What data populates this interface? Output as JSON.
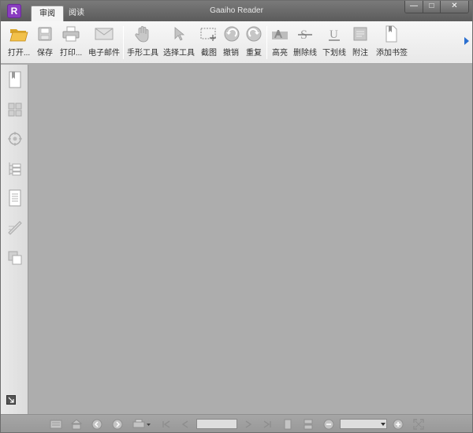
{
  "app": {
    "title": "Gaaiho Reader",
    "logo_letter": "R",
    "tabs": [
      {
        "label": "审阅",
        "active": true
      },
      {
        "label": "阅读",
        "active": false
      }
    ],
    "window_controls": {
      "minimize": "—",
      "maximize": "□",
      "close": "✕"
    }
  },
  "toolbar": {
    "buttons": [
      {
        "id": "open",
        "label": "打开...",
        "icon": "folder-open-icon"
      },
      {
        "id": "save",
        "label": "保存",
        "icon": "save-icon"
      },
      {
        "id": "print",
        "label": "打印...",
        "icon": "printer-icon"
      },
      {
        "id": "email",
        "label": "电子邮件",
        "icon": "envelope-icon"
      },
      {
        "id": "hand",
        "label": "手形工具",
        "icon": "hand-icon"
      },
      {
        "id": "select",
        "label": "选择工具",
        "icon": "cursor-icon"
      },
      {
        "id": "snapshot",
        "label": "截图",
        "icon": "snapshot-icon"
      },
      {
        "id": "undo",
        "label": "撤销",
        "icon": "undo-icon"
      },
      {
        "id": "redo",
        "label": "重复",
        "icon": "redo-icon"
      },
      {
        "id": "highlight",
        "label": "高亮",
        "icon": "highlight-icon"
      },
      {
        "id": "strikeout",
        "label": "删除线",
        "icon": "strikeout-icon"
      },
      {
        "id": "underline",
        "label": "下划线",
        "icon": "underline-icon"
      },
      {
        "id": "note",
        "label": "附注",
        "icon": "note-icon"
      },
      {
        "id": "bookmark",
        "label": "添加书签",
        "icon": "add-bookmark-icon"
      }
    ]
  },
  "sidebar": {
    "icons": [
      "bookmarks-icon",
      "thumbnails-icon",
      "layers-icon",
      "model-tree-icon",
      "pages-icon",
      "signatures-icon",
      "attachments-icon",
      "expand-panel-icon"
    ]
  },
  "statusbar": {
    "page_value": "",
    "zoom_value": ""
  },
  "colors": {
    "accent": "#8a3cc0",
    "doc_background": "#adadad",
    "titlebar": "#6a6a6a"
  }
}
